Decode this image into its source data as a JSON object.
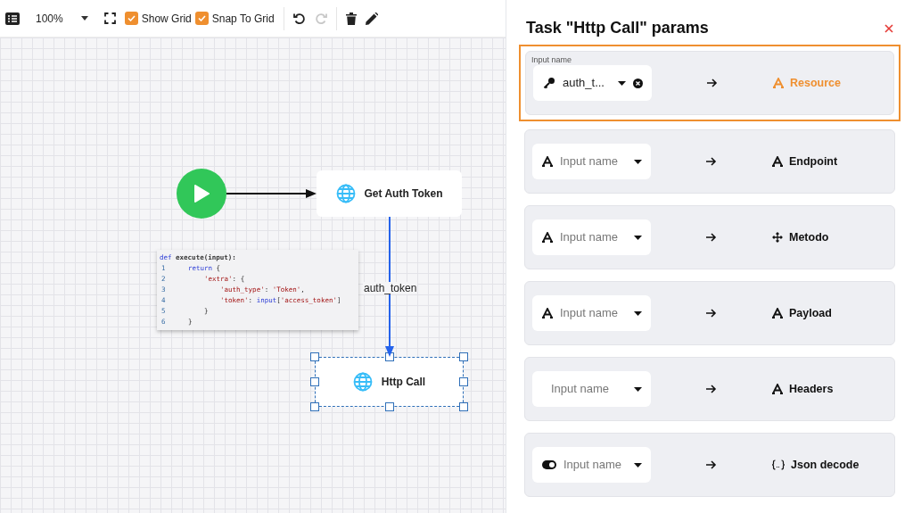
{
  "toolbar": {
    "zoom": "100%",
    "checkboxes": [
      {
        "label": "Show Grid",
        "checked": true
      },
      {
        "label": "Snap To Grid",
        "checked": true
      }
    ],
    "redo_disabled": true
  },
  "canvas": {
    "start_node": {
      "kind": "start"
    },
    "nodes": [
      {
        "label": "Get Auth Token",
        "selected": false
      },
      {
        "label": "Http Call",
        "selected": true
      }
    ],
    "edge_label": "auth_token",
    "code": {
      "header": [
        {
          "kind": "kw",
          "text": "def"
        },
        {
          "kind": "plain",
          "text": " execute(input):"
        }
      ],
      "lines": [
        {
          "num": "1",
          "segments": [
            {
              "kind": "kw",
              "text": "return"
            },
            {
              "kind": "plain",
              "text": " {"
            }
          ],
          "children": [
            {
              "num": "2",
              "segments": [
                {
                  "kind": "str",
                  "text": "'extra'"
                },
                {
                  "kind": "plain",
                  "text": ": {"
                }
              ],
              "children": [
                {
                  "num": "3",
                  "segments": [
                    {
                      "kind": "str",
                      "text": "'auth_type'"
                    },
                    {
                      "kind": "plain",
                      "text": ": "
                    },
                    {
                      "kind": "str",
                      "text": "'Token'"
                    },
                    {
                      "kind": "plain",
                      "text": ","
                    }
                  ]
                },
                {
                  "num": "4",
                  "segments": [
                    {
                      "kind": "str",
                      "text": "'token'"
                    },
                    {
                      "kind": "plain",
                      "text": ": "
                    },
                    {
                      "kind": "kw",
                      "text": "input"
                    },
                    {
                      "kind": "plain",
                      "text": "["
                    },
                    {
                      "kind": "str",
                      "text": "'access_token'"
                    },
                    {
                      "kind": "plain",
                      "text": "]"
                    }
                  ]
                }
              ]
            },
            {
              "num": "5",
              "segments": [
                {
                  "kind": "plain",
                  "text": "}"
                }
              ]
            }
          ]
        },
        {
          "num": "6",
          "segments": [
            {
              "kind": "plain",
              "text": "}"
            }
          ]
        }
      ]
    }
  },
  "panel": {
    "title": "Task \"Http Call\" params",
    "params": [
      {
        "selected": true,
        "floating_label": "Input name",
        "value": "auth_t...",
        "clearable": true,
        "input_icon": {
          "kind": "key"
        },
        "target_icon": {
          "kind": "text"
        },
        "target": "Resource"
      },
      {
        "selected": false,
        "placeholder": "Input name",
        "input_icon": {
          "kind": "text"
        },
        "target_icon": {
          "kind": "text"
        },
        "target": "Endpoint"
      },
      {
        "selected": false,
        "placeholder": "Input name",
        "input_icon": {
          "kind": "text"
        },
        "target_icon": {
          "kind": "move"
        },
        "target": "Metodo"
      },
      {
        "selected": false,
        "placeholder": "Input name",
        "input_icon": {
          "kind": "text"
        },
        "target_icon": {
          "kind": "text"
        },
        "target": "Payload"
      },
      {
        "selected": false,
        "placeholder": "Input name",
        "target_icon": {
          "kind": "text"
        },
        "target": "Headers"
      },
      {
        "selected": false,
        "placeholder": "Input name",
        "input_icon": {
          "kind": "toggle"
        },
        "target_icon": {
          "kind": "braces"
        },
        "target": "Json decode"
      }
    ]
  }
}
